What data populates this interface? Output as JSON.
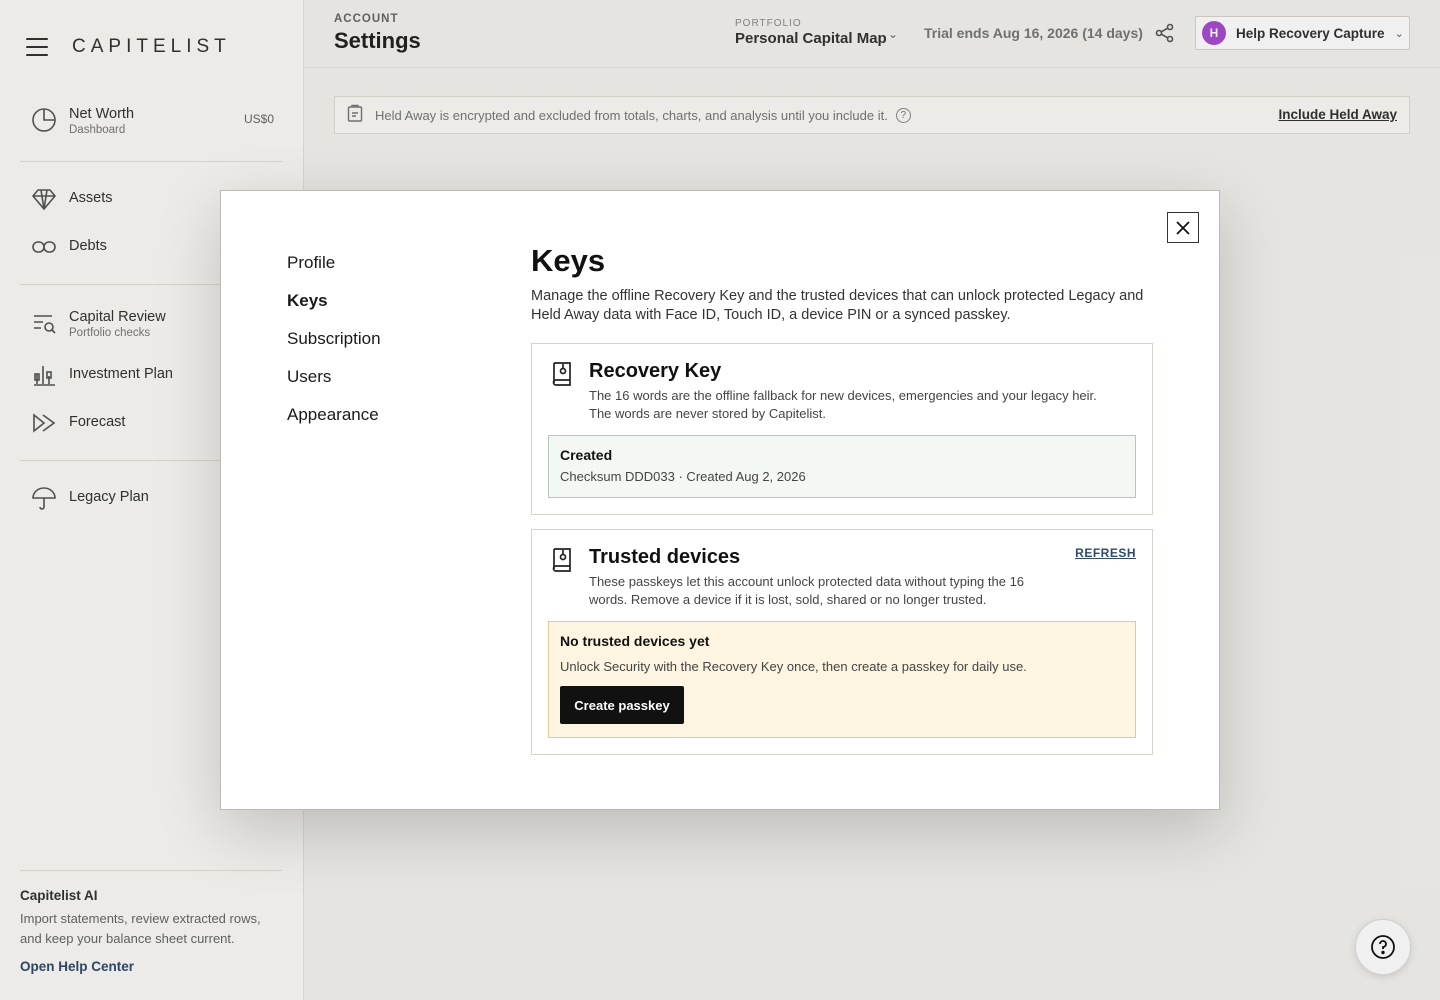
{
  "sidebar": {
    "brand": "CAPITELIST",
    "items": [
      {
        "label": "Net Worth",
        "sub": "Dashboard",
        "value": "US$0",
        "icon": "pie-chart-icon"
      },
      {
        "label": "Assets",
        "icon": "diamond-icon"
      },
      {
        "label": "Debts",
        "icon": "link-icon"
      },
      {
        "label": "Capital Review",
        "sub": "Portfolio checks",
        "icon": "review-icon"
      },
      {
        "label": "Investment Plan",
        "icon": "bar-chart-icon"
      },
      {
        "label": "Forecast",
        "icon": "fast-forward-icon"
      },
      {
        "label": "Legacy Plan",
        "icon": "umbrella-icon"
      }
    ],
    "footer": {
      "title": "Capitelist AI",
      "desc": "Import statements, review extracted rows, and keep your balance sheet current.",
      "link": "Open Help Center"
    }
  },
  "header": {
    "eyebrow": "ACCOUNT",
    "title": "Settings",
    "portfolio_eyebrow": "PORTFOLIO",
    "portfolio_name": "Personal Capital Map",
    "trial": "Trial ends Aug 16, 2026 (14 days)",
    "user_initial": "H",
    "user_name": "Help Recovery Capture"
  },
  "banner": {
    "text": "Held Away is encrypted and excluded from totals, charts, and analysis until you include it.",
    "link": "Include Held Away"
  },
  "modal": {
    "tabs": [
      "Profile",
      "Keys",
      "Subscription",
      "Users",
      "Appearance"
    ],
    "active_tab": "Keys",
    "title": "Keys",
    "desc": "Manage the offline Recovery Key and the trusted devices that can unlock protected Legacy and Held Away data with Face ID, Touch ID, a device PIN or a synced passkey.",
    "recovery": {
      "title": "Recovery Key",
      "desc": "The 16 words are the offline fallback for new devices, emergencies and your legacy heir. The words are never stored by Capitelist.",
      "status_title": "Created",
      "status_sub": "Checksum DDD033 · Created Aug 2, 2026"
    },
    "devices": {
      "title": "Trusted devices",
      "refresh": "REFRESH",
      "desc": "These passkeys let this account unlock protected data without typing the 16 words. Remove a device if it is lost, sold, shared or no longer trusted.",
      "empty_title": "No trusted devices yet",
      "empty_sub": "Unlock Security with the Recovery Key once, then create a passkey for daily use.",
      "create_button": "Create passkey"
    }
  },
  "colors": {
    "accent": "#2f4b6b",
    "avatar": "#a74ccf",
    "success_bg": "#f4f8f4",
    "warning_bg": "#fdf5e1"
  }
}
